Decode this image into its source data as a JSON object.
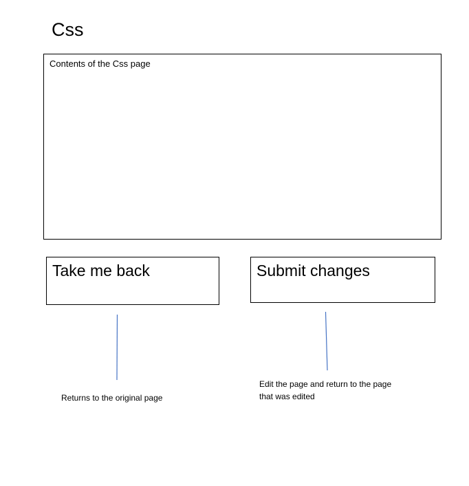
{
  "page": {
    "title": "Css",
    "content_text": "Contents of the Css page"
  },
  "buttons": {
    "back_label": "Take me back",
    "submit_label": "Submit changes"
  },
  "annotations": {
    "back_note": "Returns to the original page",
    "submit_note": "Edit the page and return to the page that was edited"
  },
  "colors": {
    "connector_line": "#4472c4"
  }
}
